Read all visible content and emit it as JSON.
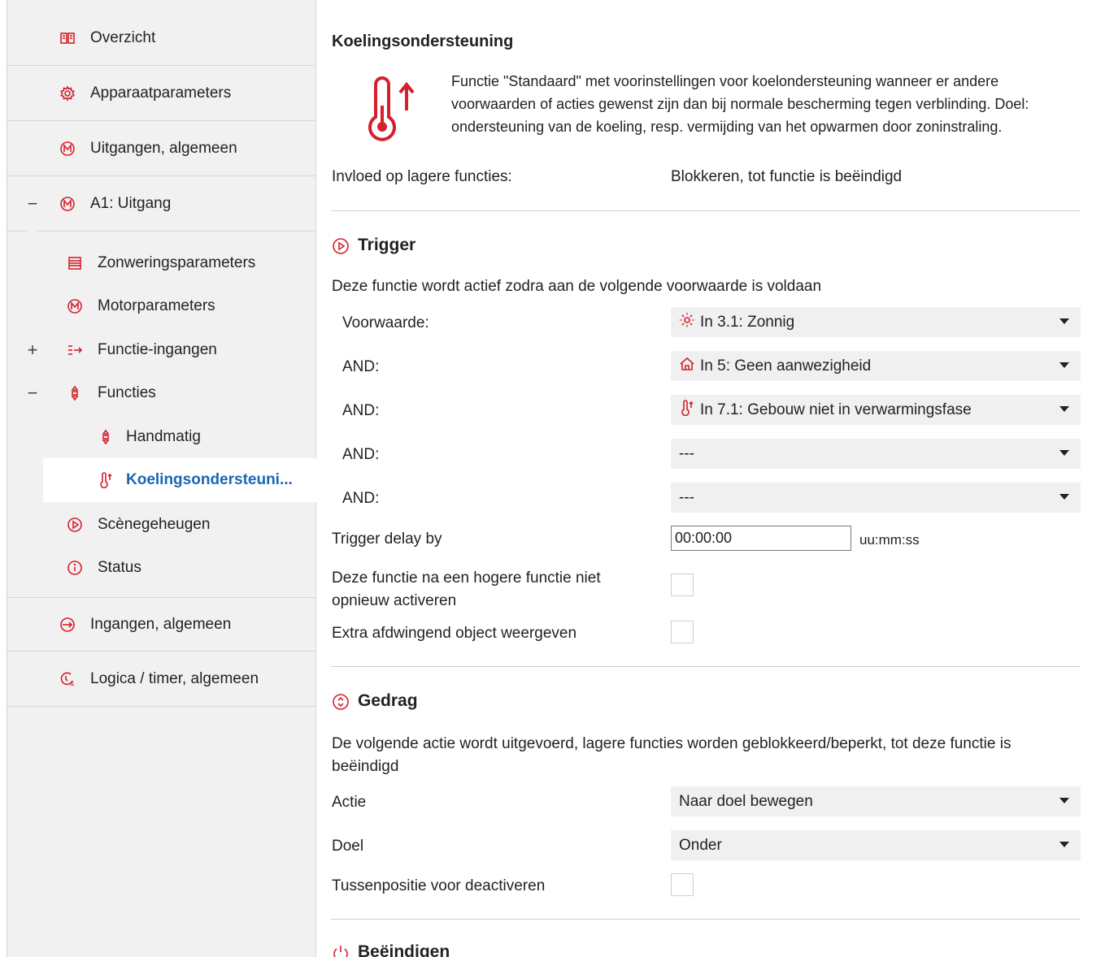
{
  "sidebar": {
    "items": [
      {
        "label": "Overzicht",
        "icon": "book-icon"
      },
      {
        "label": "Apparaatparameters",
        "icon": "gear-icon"
      },
      {
        "label": "Uitgangen, algemeen",
        "icon": "motor-icon"
      },
      {
        "label": "A1: Uitgang",
        "icon": "motor-icon",
        "toggle": "−"
      },
      {
        "label": "Zonweringsparameters",
        "icon": "blind-icon"
      },
      {
        "label": "Motorparameters",
        "icon": "motor-icon"
      },
      {
        "label": "Functie-ingangen",
        "icon": "function-input-icon",
        "toggle": "+"
      },
      {
        "label": "Functies",
        "icon": "functions-icon",
        "toggle": "−"
      },
      {
        "label": "Handmatig",
        "icon": "manual-icon"
      },
      {
        "label": "Koelingsondersteuni...",
        "icon": "thermometer-icon"
      },
      {
        "label": "Scènegeheugen",
        "icon": "scene-icon"
      },
      {
        "label": "Status",
        "icon": "info-icon"
      },
      {
        "label": "Ingangen, algemeen",
        "icon": "input-icon"
      },
      {
        "label": "Logica / timer, algemeen",
        "icon": "logic-timer-icon"
      }
    ]
  },
  "main": {
    "title": "Koelingsondersteuning",
    "description": "Functie \"Standaard\" met voorinstellingen voor koelondersteuning wanneer er andere voorwaarden of acties gewenst zijn dan bij normale bescherming tegen verblinding. Doel: ondersteuning van de koeling, resp. vermijding van het opwarmen door zoninstraling.",
    "influence_label": "Invloed op lagere functies:",
    "influence_value": "Blokkeren, tot functie is beëindigd",
    "trigger": {
      "heading": "Trigger",
      "intro": "Deze functie wordt actief zodra aan de volgende voorwaarde is voldaan",
      "rows": [
        {
          "label": "Voorwaarde:",
          "value": "In 3.1: Zonnig",
          "icon": "sun-icon"
        },
        {
          "label": "AND:",
          "value": "In 5: Geen aanwezigheid",
          "icon": "house-icon"
        },
        {
          "label": "AND:",
          "value": "In 7.1: Gebouw niet in verwarmingsfase",
          "icon": "thermometer-icon"
        },
        {
          "label": "AND:",
          "value": "---"
        },
        {
          "label": "AND:",
          "value": "---"
        }
      ],
      "delay_label": "Trigger delay by",
      "delay_value": "00:00:00",
      "delay_unit": "uu:mm:ss",
      "reactivate_label": "Deze functie na een hogere functie niet opnieuw activeren",
      "extra_label": "Extra afdwingend object weergeven"
    },
    "gedrag": {
      "heading": "Gedrag",
      "intro": "De volgende actie wordt uitgevoerd, lagere functies worden geblokkeerd/beperkt, tot deze functie is beëindigd",
      "actie_label": "Actie",
      "actie_value": "Naar doel bewegen",
      "doel_label": "Doel",
      "doel_value": "Onder",
      "tussen_label": "Tussenpositie voor deactiveren"
    },
    "end": {
      "heading": "Beëindigen"
    }
  },
  "colors": {
    "accent": "#d5202d",
    "link": "#1a66b3",
    "sidebar_bg": "#f1f1f1",
    "combo_bg": "#f0f0f0"
  }
}
